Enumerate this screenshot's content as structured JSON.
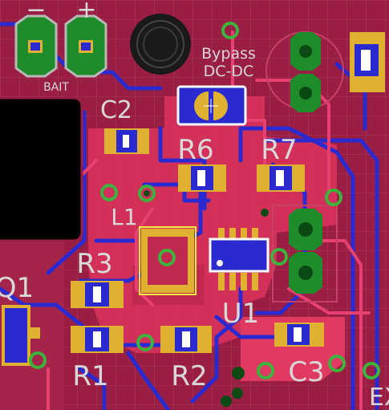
{
  "colors": {
    "board": "#9a1e44",
    "copper_pour": "#e03a63",
    "trace_blue": "#2a2ad0",
    "trace_red": "#e84070",
    "pad_gold": "#e0b030",
    "pad_green": "#1e8c2a",
    "via_green": "#3cb43c",
    "silk": "#d8d8d8",
    "highlight": "#f0f040"
  },
  "silkscreen": {
    "bait": "BAIT",
    "minus": "−",
    "plus": "+",
    "c2": "C2",
    "bypass": "Bypass",
    "dcdc": "DC-DC",
    "r6": "R6",
    "r7": "R7",
    "l1": "L1",
    "r3": "R3",
    "q1": "Q1",
    "u1": "U1",
    "r1": "R1",
    "r2": "R2",
    "c3": "C3",
    "ex": "EX"
  },
  "icons": {
    "battery_pads": "through-hole-pad-pair",
    "mounting_hole": "mounting-hole-icon",
    "header_pads": "octagon-pad-icon"
  }
}
